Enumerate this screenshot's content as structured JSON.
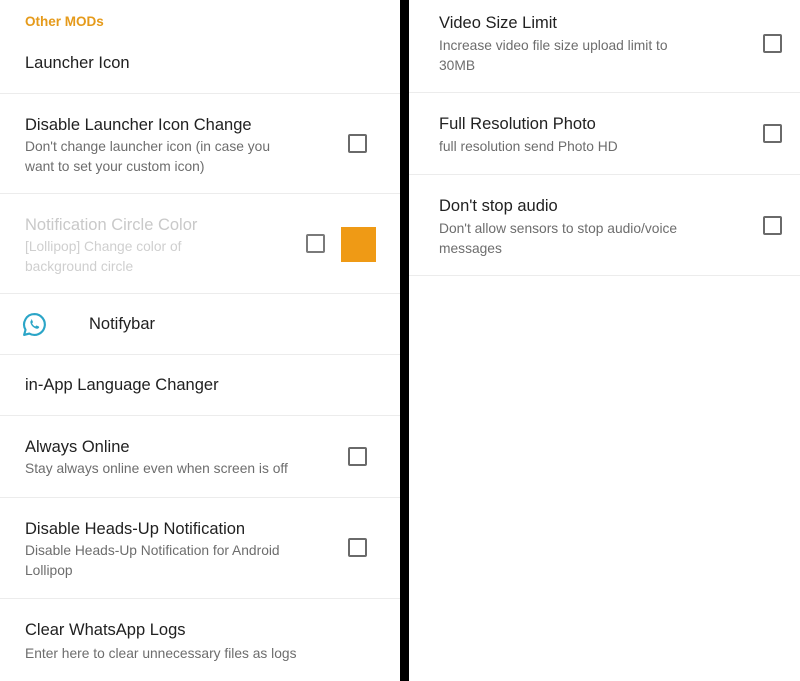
{
  "left": {
    "section_header": "Other MODs",
    "launcher_icon": {
      "title": "Launcher Icon"
    },
    "disable_launcher_change": {
      "title": "Disable Launcher Icon Change",
      "summary_line1": "Don't change launcher icon (in case you",
      "summary_line2": "want to set your custom icon)",
      "checked": false
    },
    "notification_circle": {
      "title": "Notification Circle Color",
      "summary_line1": "[Lollipop] Change color of",
      "summary_line2": "background circle",
      "checked": false,
      "enabled": false,
      "swatch_color": "#ef9a15"
    },
    "notifybar": {
      "title": "Notifybar",
      "icon": "whatsapp-icon"
    },
    "language_changer": {
      "title": "in-App Language Changer"
    },
    "always_online": {
      "title": "Always Online",
      "summary": "Stay always online even when screen is off",
      "checked": false
    },
    "heads_up": {
      "title": "Disable Heads-Up Notification",
      "summary_line1": "Disable Heads-Up Notification for Android",
      "summary_line2": "Lollipop",
      "checked": false
    },
    "clear_logs": {
      "title": "Clear WhatsApp Logs",
      "summary": "Enter here to clear unnecessary files as logs"
    }
  },
  "right": {
    "video_size": {
      "title": "Video Size Limit",
      "summary_line1": "Increase video file size upload limit to",
      "summary_line2": "30MB",
      "checked": false
    },
    "full_res_photo": {
      "title": "Full Resolution Photo",
      "summary": "full resolution send Photo HD",
      "checked": false
    },
    "dont_stop_audio": {
      "title": "Don't stop audio",
      "summary_line1": "Don't allow sensors to stop audio/voice",
      "summary_line2": "messages",
      "checked": false
    }
  },
  "colors": {
    "accent": "#e59a1a",
    "swatch": "#ef9a15",
    "divider": "#000000"
  }
}
